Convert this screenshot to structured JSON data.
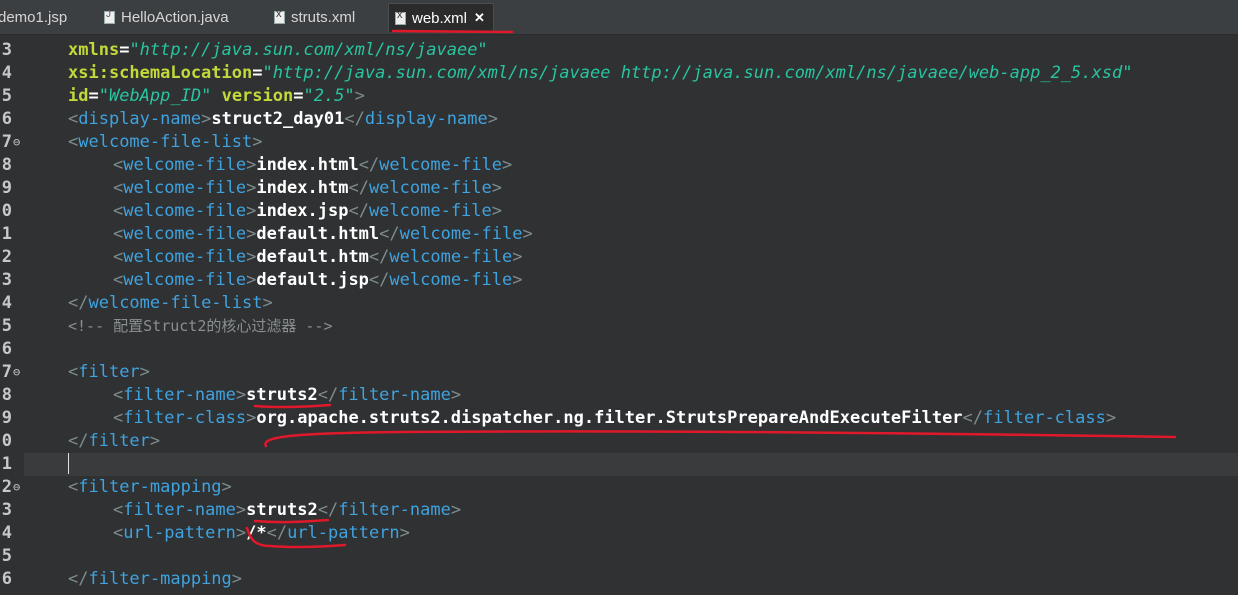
{
  "tabs": [
    {
      "label": "demo1.jsp",
      "icon": "jsp-file-icon"
    },
    {
      "label": "HelloAction.java",
      "icon": "java-file-icon"
    },
    {
      "label": "struts.xml",
      "icon": "xml-file-icon"
    },
    {
      "label": "web.xml",
      "icon": "xml-file-icon",
      "active": true,
      "close": "✕"
    }
  ],
  "gutter": [
    "3",
    "4",
    "5",
    "6",
    "7",
    "8",
    "9",
    "0",
    "1",
    "2",
    "3",
    "4",
    "5",
    "6",
    "7",
    "8",
    "9",
    "0",
    "1",
    "2",
    "3",
    "4",
    "5",
    "6"
  ],
  "code": {
    "l3": {
      "attr": "xmlns",
      "eq": "=",
      "val": "\"http://java.sun.com/xml/ns/javaee\""
    },
    "l4": {
      "attr": "xsi:schemaLocation",
      "eq": "=",
      "val": "\"http://java.sun.com/xml/ns/javaee http://java.sun.com/xml/ns/javaee/web-app_2_5.xsd\""
    },
    "l5": {
      "attr1": "id",
      "eq": "=",
      "val1": "\"WebApp_ID\"",
      "attr2": "version",
      "val2": "\"2.5\"",
      "close": ">"
    },
    "display_name": {
      "tag": "display-name",
      "text": "struct2_day01"
    },
    "welcome_list": "welcome-file-list",
    "welcome_tag": "welcome-file",
    "welcome_files": [
      "index.html",
      "index.htm",
      "index.jsp",
      "default.html",
      "default.htm",
      "default.jsp"
    ],
    "comment": "<!-- 配置Struct2的核心过滤器 -->",
    "filter": "filter",
    "filter_name_tag": "filter-name",
    "filter_name": "struts2",
    "filter_class_tag": "filter-class",
    "filter_class": "org.apache.struts2.dispatcher.ng.filter.StrutsPrepareAndExecuteFilter",
    "filter_mapping": "filter-mapping",
    "url_pattern_tag": "url-pattern",
    "url_pattern": "/*"
  },
  "colors": {
    "tag": "#3fa3e0",
    "attribute": "#c3d93a",
    "string": "#29c4a0",
    "text": "#ffffff",
    "bracket": "#7e8c8d",
    "annotation": "#e0192a"
  }
}
